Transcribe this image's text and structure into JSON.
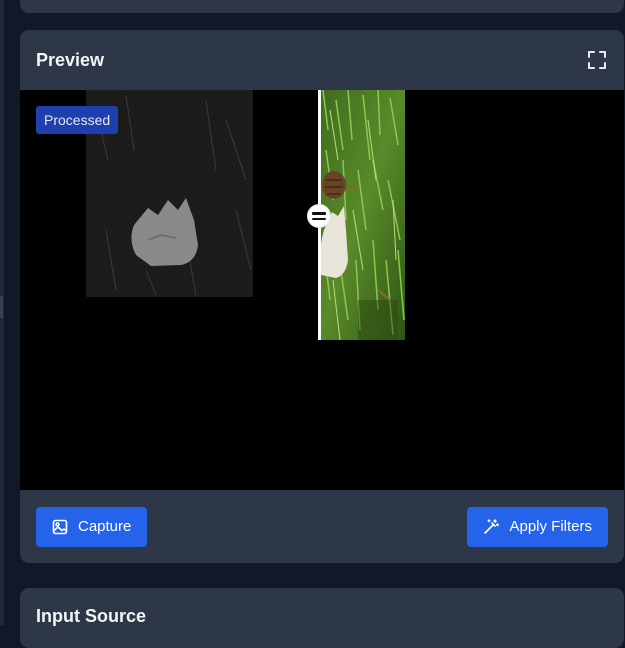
{
  "preview": {
    "title": "Preview",
    "fullscreen_icon": "fullscreen-icon",
    "badge_label": "Processed",
    "compare_handle_icon": "drag-handle-icon"
  },
  "actions": {
    "capture_label": "Capture",
    "capture_icon": "image-icon",
    "apply_label": "Apply Filters",
    "apply_icon": "magic-wand-icon"
  },
  "input_source": {
    "title": "Input Source"
  },
  "colors": {
    "page_bg": "#111827",
    "card_bg": "#2d3748",
    "accent": "#2563eb",
    "badge_bg": "#1e40af"
  }
}
